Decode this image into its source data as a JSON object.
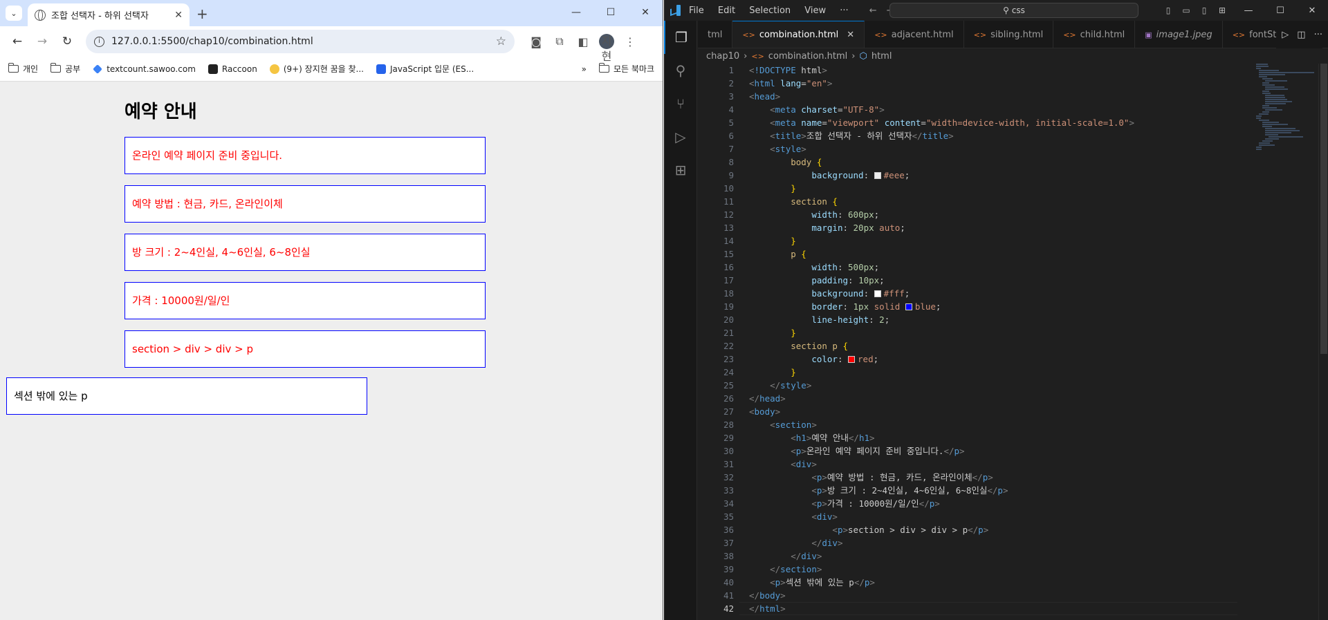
{
  "browser": {
    "tab_title": "조합 선택자 - 하위 선택자",
    "url": "127.0.0.1:5500/chap10/combination.html",
    "bookmarks": [
      "개인",
      "공부",
      "textcount.sawoo.com",
      "Raccoon",
      "(9+) 장지현 꿈을 찾...",
      "JavaScript 입문 (ES..."
    ],
    "all_bookmarks": "모든 북마크",
    "profile_initials": "지현"
  },
  "page": {
    "heading": "예약 안내",
    "paragraphs": [
      "온라인 예약 페이지 준비 중입니다.",
      "예약 방법 : 현금, 카드, 온라인이체",
      "방 크기 : 2~4인실, 4~6인실, 6~8인실",
      "가격 : 10000원/일/인",
      "section > div > div > p"
    ],
    "outside": "섹션 밖에 있는 p"
  },
  "vscode": {
    "menu": [
      "File",
      "Edit",
      "Selection",
      "View",
      "···"
    ],
    "search": "css",
    "tabs": [
      {
        "name": "tml",
        "type": "html"
      },
      {
        "name": "combination.html",
        "type": "html",
        "active": true
      },
      {
        "name": "adjacent.html",
        "type": "html"
      },
      {
        "name": "sibling.html",
        "type": "html"
      },
      {
        "name": "child.html",
        "type": "html"
      },
      {
        "name": "image1.jpeg",
        "type": "image"
      },
      {
        "name": "fontStyle.h",
        "type": "html"
      }
    ],
    "breadcrumb": [
      "chap10",
      "combination.html",
      "html"
    ],
    "current_line": 42,
    "code_lines": [
      "<!DOCTYPE html>",
      "<html lang=\"en\">",
      "<head>",
      "    <meta charset=\"UTF-8\">",
      "    <meta name=\"viewport\" content=\"width=device-width, initial-scale=1.0\">",
      "    <title>조합 선택자 - 하위 선택자</title>",
      "    <style>",
      "        body {",
      "            background: #eee;",
      "        }",
      "        section {",
      "            width: 600px;",
      "            margin: 20px auto;",
      "        }",
      "        p {",
      "            width: 500px;",
      "            padding: 10px;",
      "            background: #fff;",
      "            border: 1px solid blue;",
      "            line-height: 2;",
      "        }",
      "        section p {",
      "            color: red;",
      "        }",
      "    </style>",
      "</head>",
      "<body>",
      "    <section>",
      "        <h1>예약 안내</h1>",
      "        <p>온라인 예약 페이지 준비 중입니다.</p>",
      "        <div>",
      "            <p>예약 방법 : 현금, 카드, 온라인이체</p>",
      "            <p>방 크기 : 2~4인실, 4~6인실, 6~8인실</p>",
      "            <p>가격 : 10000원/일/인</p>",
      "            <div>",
      "                <p>section > div > div > p</p>",
      "            </div>",
      "        </div>",
      "    </section>",
      "    <p>섹션 밖에 있는 p</p>",
      "</body>",
      "</html>"
    ]
  }
}
